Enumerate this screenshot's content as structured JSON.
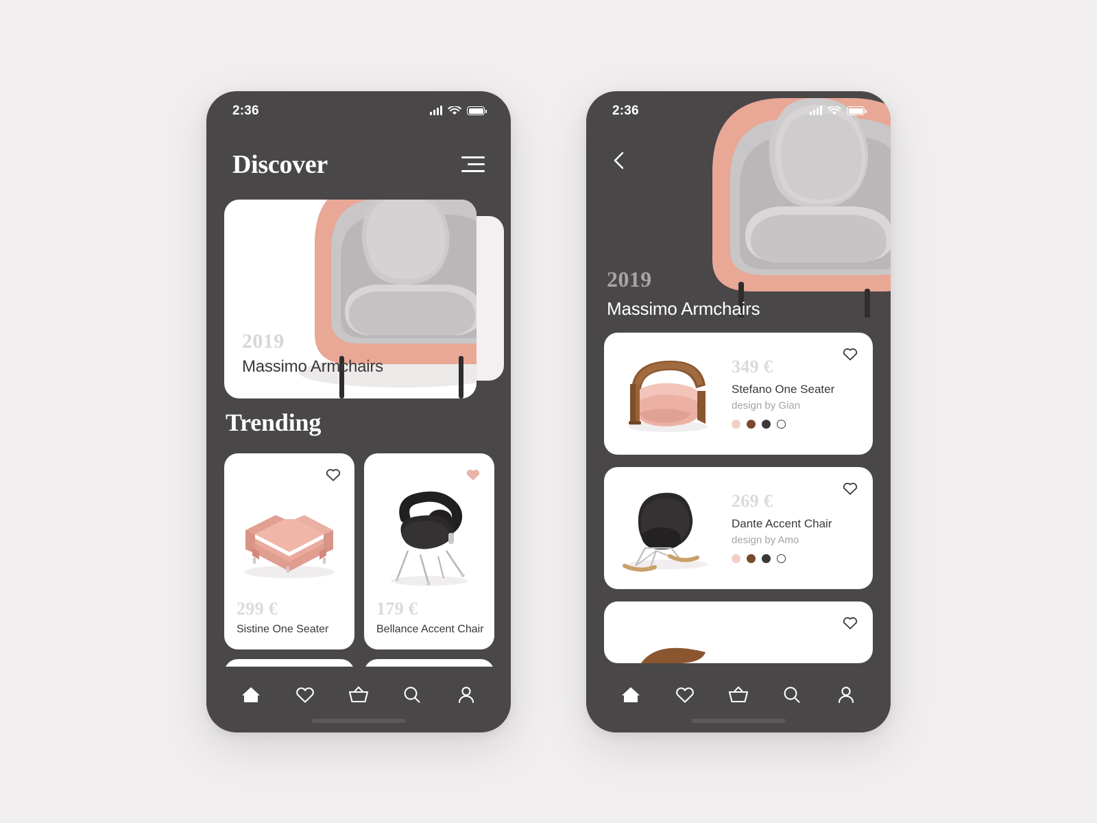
{
  "theme": {
    "page_bg": "#f0eeee",
    "phone_bg": "#4a4748",
    "card_bg": "#ffffff",
    "accent_pink": "#e8b4a8",
    "price_gray": "#dcd9d9",
    "text_dark": "#3a3838",
    "muted": "#a6a2a2"
  },
  "status_bar": {
    "time": "2:36",
    "signal_icon": "cellular-signal-icon",
    "wifi_icon": "wifi-icon",
    "battery_icon": "battery-icon"
  },
  "discover_screen": {
    "title": "Discover",
    "menu_icon": "hamburger-menu-icon",
    "hero": {
      "year": "2019",
      "name": "Massimo Armchairs",
      "image_alt": "pink-armchair-with-gray-cushions"
    },
    "section_title": "Trending",
    "products": [
      {
        "price": "299 €",
        "name": "Sistine One Seater",
        "favorite": false,
        "heart_icon": "heart-outline-icon",
        "image_alt": "pink-two-seater-sofa"
      },
      {
        "price": "179 €",
        "name": "Bellance Accent Chair",
        "favorite": true,
        "heart_icon": "heart-filled-icon",
        "image_alt": "black-accent-chair-metal-legs"
      }
    ]
  },
  "detail_screen": {
    "back_icon": "chevron-left-icon",
    "hero": {
      "year": "2019",
      "name": "Massimo Armchairs",
      "image_alt": "pink-armchair-with-gray-cushions"
    },
    "products": [
      {
        "price": "349 €",
        "name": "Stefano One Seater",
        "designer": "design by Gian",
        "favorite": false,
        "heart_icon": "heart-outline-icon",
        "image_alt": "wooden-frame-pink-cushion-chair",
        "swatches": [
          "#f1cfc6",
          "#7a4a2c",
          "#3a3838",
          "#ffffff"
        ]
      },
      {
        "price": "269 €",
        "name": "Dante Accent Chair",
        "designer": "design by Amo",
        "favorite": false,
        "heart_icon": "heart-outline-icon",
        "image_alt": "black-rocking-chair-wooden-runners",
        "swatches": [
          "#f1cfc6",
          "#7a4a2c",
          "#3a3838",
          "#ffffff"
        ]
      }
    ]
  },
  "bottom_nav": {
    "items": [
      {
        "icon": "home-icon",
        "active": true
      },
      {
        "icon": "heart-icon",
        "active": false
      },
      {
        "icon": "basket-icon",
        "active": false
      },
      {
        "icon": "search-icon",
        "active": false
      },
      {
        "icon": "user-icon",
        "active": false
      }
    ]
  }
}
